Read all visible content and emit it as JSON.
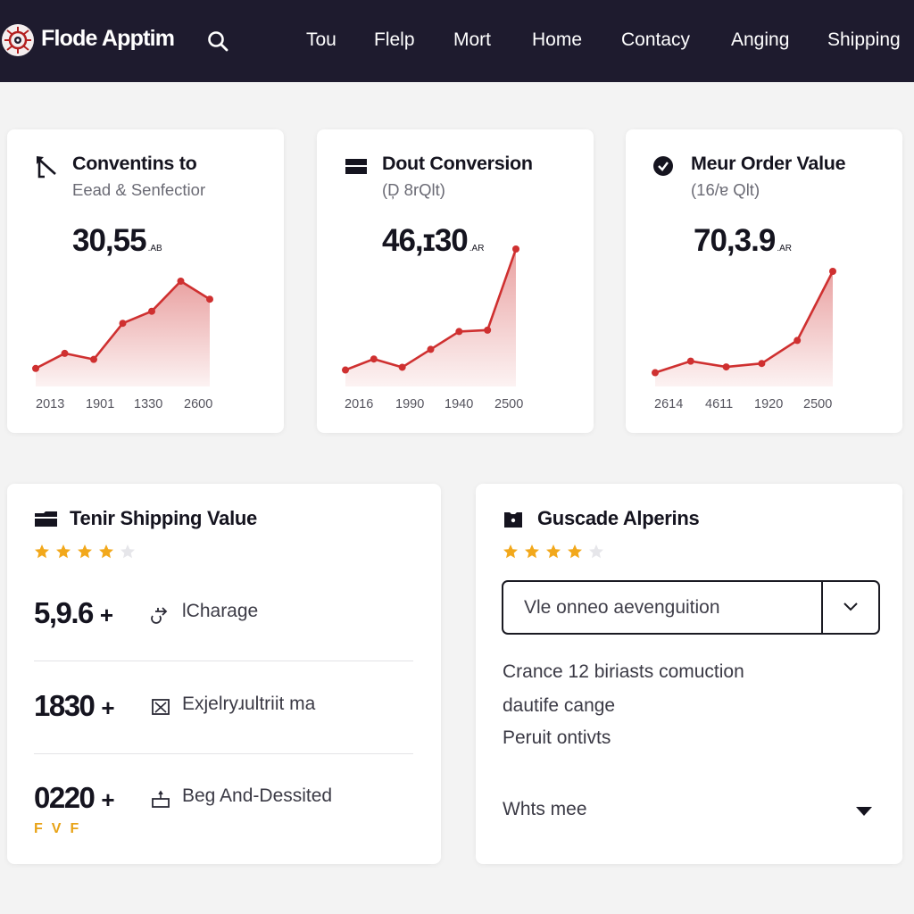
{
  "app": {
    "title": "Flode Apptim",
    "logo_icon": "eye-gear-logo",
    "search_icon": "search-icon"
  },
  "nav": {
    "items": [
      {
        "label": "Tou"
      },
      {
        "label": "Flelp"
      },
      {
        "label": "Mort"
      },
      {
        "label": "Home"
      },
      {
        "label": "Contacy"
      },
      {
        "label": "Anging"
      },
      {
        "label": "Shipping"
      }
    ]
  },
  "colors": {
    "topbar": "#1e1b2e",
    "accent_red": "#cf3030",
    "star_gold": "#f2a81b",
    "star_empty": "#e6e6ea"
  },
  "kpis": [
    {
      "icon": "arrow-up-left-icon",
      "title": "Conventins to",
      "subtitle": "Eead & Senfectior",
      "value": "30,55",
      "unit": ".AB",
      "x_labels": [
        "2013",
        "1901",
        "1330",
        "2600"
      ]
    },
    {
      "icon": "inbox-tray-icon",
      "title": "Dout Conversion",
      "subtitle": "(Ḑ 8rQlt)",
      "value": "46,ɪ30",
      "unit": ".AR",
      "x_labels": [
        "2016",
        "1990",
        "1940",
        "2500"
      ]
    },
    {
      "icon": "check-circle-icon",
      "title": "Meur Order Value",
      "subtitle": "(16/ɐ Qlt)",
      "value": "70,3.9",
      "unit": ".AR",
      "x_labels": [
        "2614",
        "4611",
        "1920",
        "2500"
      ]
    }
  ],
  "chart_data": [
    {
      "type": "area",
      "title": "Conventins to",
      "x": [
        1,
        2,
        3,
        4,
        5,
        6,
        7
      ],
      "tick_labels": [
        "2013",
        "1901",
        "1330",
        "2600"
      ],
      "values": [
        12,
        22,
        18,
        42,
        50,
        70,
        58
      ],
      "ylim": [
        0,
        80
      ],
      "grid": false
    },
    {
      "type": "area",
      "title": "Dout Conversion",
      "x": [
        1,
        2,
        3,
        4,
        5,
        6,
        7,
        8
      ],
      "tick_labels": [
        "2016",
        "1990",
        "1940",
        "2500"
      ],
      "values": [
        12,
        20,
        14,
        27,
        40,
        41,
        100
      ],
      "ylim": [
        0,
        110
      ],
      "grid": false
    },
    {
      "type": "area",
      "title": "Meur Order Value",
      "x": [
        1,
        2,
        3,
        4,
        5,
        6
      ],
      "tick_labels": [
        "2614",
        "4611",
        "1920",
        "2500"
      ],
      "values": [
        12,
        22,
        17,
        20,
        40,
        100
      ],
      "ylim": [
        0,
        110
      ],
      "grid": false
    }
  ],
  "shipping": {
    "icon": "tray-icon",
    "title": "Tenir Shipping Value",
    "rating": 4,
    "rating_max": 5,
    "stats": [
      {
        "value": "5,9.6",
        "suffix": "+",
        "icon": "exchange-icon",
        "label": "lCharage"
      },
      {
        "value": "1830",
        "suffix": "+",
        "icon": "x-box-icon",
        "label": "Exjelryɹultriit ma"
      },
      {
        "value": "0220",
        "suffix": "+",
        "icon": "cake-icon",
        "label": "Beg And-Dessited"
      }
    ],
    "badges": [
      "F",
      "V",
      "F"
    ]
  },
  "alperins": {
    "icon": "camera-box-icon",
    "title": "Guscade Alperins",
    "rating": 4,
    "rating_max": 5,
    "select_value": "Vle onneo aevenguition",
    "info_lines": [
      "Crance 12 biriasts comuction",
      "dautife cange",
      "Peruit ontivts"
    ],
    "footer_select": "Whts mee"
  }
}
